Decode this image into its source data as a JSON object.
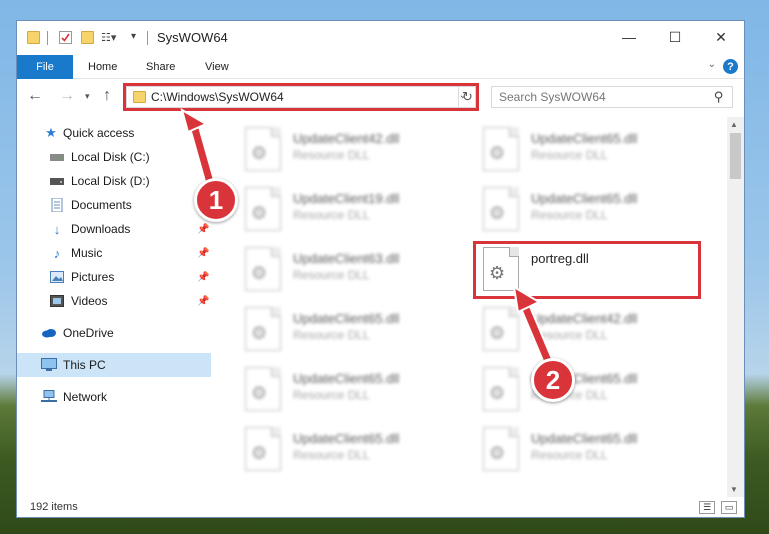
{
  "window": {
    "title": "SysWOW64",
    "controls": {
      "minimize": "—",
      "maximize": "☐",
      "close": "✕"
    }
  },
  "ribbon": {
    "tabs": [
      "File",
      "Home",
      "Share",
      "View"
    ],
    "help": "?"
  },
  "address_bar": {
    "path": "C:\\Windows\\SysWOW64",
    "search_placeholder": "Search SysWOW64"
  },
  "sidebar": {
    "items": [
      {
        "label": "Quick access",
        "icon": "star-icon"
      },
      {
        "label": "Local Disk (C:)",
        "icon": "drive-icon",
        "pinned": true
      },
      {
        "label": "Local Disk (D:)",
        "icon": "drive-icon",
        "pinned": true
      },
      {
        "label": "Documents",
        "icon": "documents-icon",
        "pinned": true
      },
      {
        "label": "Downloads",
        "icon": "downloads-icon",
        "pinned": true
      },
      {
        "label": "Music",
        "icon": "music-icon",
        "pinned": true
      },
      {
        "label": "Pictures",
        "icon": "pictures-icon",
        "pinned": true
      },
      {
        "label": "Videos",
        "icon": "videos-icon",
        "pinned": true
      },
      {
        "label": "OneDrive",
        "icon": "onedrive-icon"
      },
      {
        "label": "This PC",
        "icon": "this-pc-icon",
        "selected": true
      },
      {
        "label": "Network",
        "icon": "network-icon"
      }
    ]
  },
  "files": {
    "left_column": [
      {
        "name": "UpdateClient42.dll",
        "type": "Resource DLL"
      },
      {
        "name": "UpdateClient19.dll",
        "type": "Resource DLL"
      },
      {
        "name": "UpdateClient63.dll",
        "type": "Resource DLL"
      },
      {
        "name": "UpdateClient65.dll",
        "type": "Resource DLL"
      },
      {
        "name": "UpdateClient65.dll",
        "type": "Resource DLL"
      },
      {
        "name": "UpdateClient65.dll",
        "type": "Resource DLL"
      }
    ],
    "right_column": [
      {
        "name": "UpdateClient65.dll",
        "type": "Resource DLL"
      },
      {
        "name": "UpdateClient65.dll",
        "type": "Resource DLL"
      },
      {
        "name": "portreg.dll",
        "type": ""
      },
      {
        "name": "UpdateClient42.dll",
        "type": "Resource DLL"
      },
      {
        "name": "UpdateClient65.dll",
        "type": "Resource DLL"
      },
      {
        "name": "UpdateClient65.dll",
        "type": "Resource DLL"
      }
    ]
  },
  "status_bar": {
    "item_count": "192 items"
  },
  "annotations": {
    "step1": "1",
    "step2": "2"
  },
  "colors": {
    "accent": "#1979ca",
    "highlight": "#d9343a",
    "selected": "#cce4f7"
  }
}
